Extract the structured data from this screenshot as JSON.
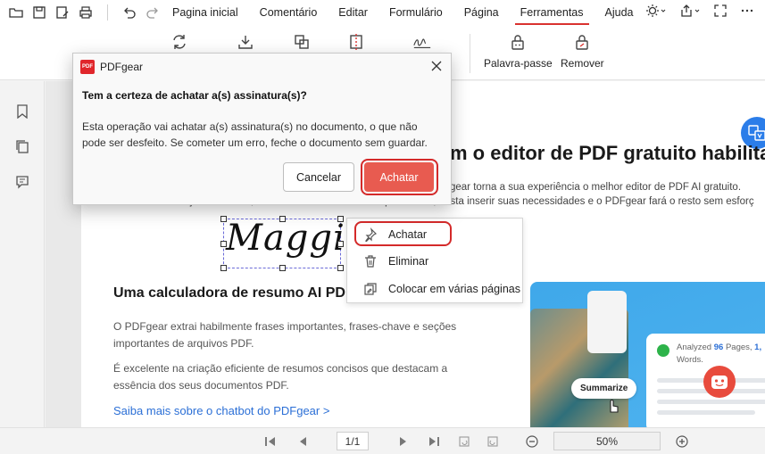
{
  "menubar": {
    "items": [
      "Pagina inicial",
      "Comentário",
      "Editar",
      "Formulário",
      "Página",
      "Ferramentas",
      "Ajuda"
    ],
    "active": "Ferramentas"
  },
  "ribbon": {
    "password_label": "Palavra-passe",
    "remove_label": "Remover"
  },
  "document": {
    "hero_title": "m o editor de PDF gratuito habilitad",
    "hero_line1": "gear torna a sua experiência o melhor editor de PDF AI gratuito.",
    "hero_line2": "Esteja você lendo, convertendo ou editando arquivos PDF, basta inserir suas necessidades e o PDFgear fará o resto sem esforç",
    "signature": "Maggie",
    "section_title": "Uma calculadora de resumo AI PDF",
    "para1": "O PDFgear extrai habilmente frases importantes, frases-chave e seções importantes de arquivos PDF.",
    "para2": "É excelente na criação eficiente de resumos concisos que destacam a essência dos seus documentos PDF.",
    "link": "Saiba mais sobre o chatbot do PDFgear >",
    "promo": {
      "analyzed_prefix": "Analyzed ",
      "analyzed_pages": "96",
      "analyzed_suffix": " Pages, ",
      "analyzed_more": "1,",
      "words": "Words.",
      "summarize": "Summarize"
    }
  },
  "context_menu": {
    "items": [
      "Achatar",
      "Eliminar",
      "Colocar em várias páginas"
    ]
  },
  "dialog": {
    "title": "PDFgear",
    "logo_text": "PDF",
    "question": "Tem a certeza de achatar a(s) assinatura(s)?",
    "body": "Esta operação vai achatar a(s) assinatura(s) no documento, o que não pode ser desfeito. Se cometer um erro, feche o documento sem guardar.",
    "cancel": "Cancelar",
    "confirm": "Achatar"
  },
  "statusbar": {
    "page": "1/1",
    "zoom": "50%"
  },
  "colors": {
    "accent": "#d9322f",
    "confirm_button": "#e85b50",
    "link": "#2b6fd6"
  }
}
